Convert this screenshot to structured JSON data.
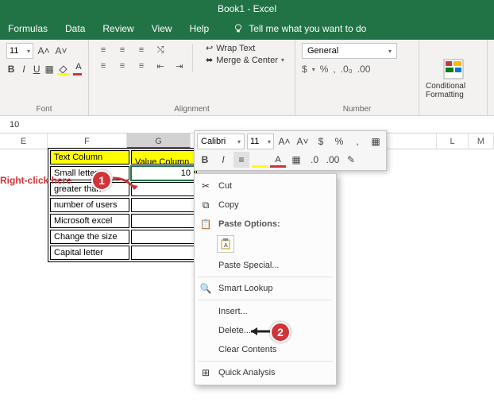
{
  "title": "Book1  -  Excel",
  "tabs": {
    "formulas": "Formulas",
    "data": "Data",
    "review": "Review",
    "view": "View",
    "help": "Help",
    "tell": "Tell me what you want to do"
  },
  "ribbon": {
    "font": {
      "size": "11",
      "label": "Font",
      "bold": "B",
      "italic": "I",
      "underline": "U",
      "grow": "A˄",
      "shrink": "A˅",
      "fontA": "A"
    },
    "alignment": {
      "label": "Alignment",
      "wrap": "Wrap Text",
      "merge": "Merge & Center"
    },
    "number": {
      "label": "Number",
      "format": "General",
      "currency": "$",
      "percent": "%",
      "comma": ",",
      "inc": ".0₀",
      "dec": ".00"
    },
    "cond": {
      "label": "Conditional Formatting"
    }
  },
  "formulaBar": "10",
  "columns": {
    "E": "E",
    "F": "F",
    "G": "G",
    "L": "L",
    "M": "M"
  },
  "table": {
    "headers": {
      "text": "Text Column",
      "value": "Value Column"
    },
    "rows": [
      {
        "text": "Small letters",
        "value": "10"
      },
      {
        "text": "greater than",
        "value": ""
      },
      {
        "text": "number of users",
        "value": ""
      },
      {
        "text": "Microsoft excel",
        "value": ""
      },
      {
        "text": "Change the size",
        "value": ""
      },
      {
        "text": "Capital letter",
        "value": ""
      }
    ]
  },
  "miniToolbar": {
    "font": "Calibri",
    "size": "11",
    "bold": "B",
    "italic": "I",
    "percent": "%",
    "comma": ","
  },
  "contextMenu": {
    "cut": "Cut",
    "copy": "Copy",
    "pasteOptions": "Paste Options:",
    "pasteSpecial": "Paste Special...",
    "smartLookup": "Smart Lookup",
    "insert": "Insert...",
    "delete": "Delete...",
    "clear": "Clear Contents",
    "quick": "Quick Analysis"
  },
  "callouts": {
    "rightClick": "Right-click here",
    "badge1": "1",
    "badge2": "2"
  }
}
